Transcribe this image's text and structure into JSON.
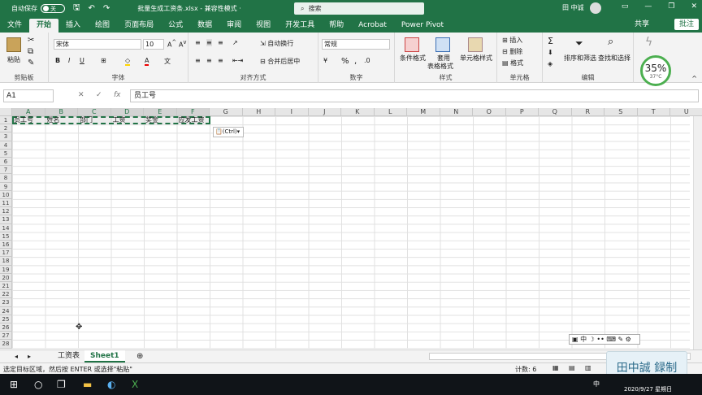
{
  "titlebar": {
    "autosave": "自动保存",
    "toggle": "关",
    "title": "批量生成工资条.xlsx  -  兼容性模式  ·",
    "search": "搜索",
    "user": "田 中诚"
  },
  "tabs": [
    "文件",
    "开始",
    "插入",
    "绘图",
    "页面布局",
    "公式",
    "数据",
    "审阅",
    "视图",
    "开发工具",
    "帮助",
    "Acrobat",
    "Power Pivot"
  ],
  "share": "共享",
  "comment": "批注",
  "ribbon": {
    "clipboard": {
      "label": "剪贴板",
      "paste": "粘贴"
    },
    "font": {
      "label": "字体",
      "name": "宋体",
      "size": "10"
    },
    "align": {
      "label": "对齐方式",
      "wrap": "自动换行",
      "merge": "合并后居中"
    },
    "number": {
      "label": "数字",
      "format": "常规"
    },
    "styles": {
      "label": "样式",
      "cond": "条件格式",
      "table1": "套用",
      "table2": "表格格式",
      "cell": "单元格样式"
    },
    "cells": {
      "label": "单元格",
      "insert": "插入",
      "delete": "删除",
      "format": "格式"
    },
    "edit": {
      "label": "编辑",
      "sort": "排序和筛选",
      "find": "查找和选择"
    },
    "gauge": {
      "pct": "35%",
      "temp": "37°C"
    }
  },
  "formula": {
    "namebox": "A1",
    "fx": "fx",
    "value": "员工号"
  },
  "columns": [
    "A",
    "B",
    "C",
    "D",
    "E",
    "F",
    "G",
    "H",
    "I",
    "J",
    "K",
    "L",
    "M",
    "N",
    "O",
    "P",
    "Q",
    "R",
    "S",
    "T",
    "U"
  ],
  "rows": [
    "1",
    "2",
    "3",
    "4",
    "5",
    "6",
    "7",
    "8",
    "9",
    "10",
    "11",
    "12",
    "13",
    "14",
    "15",
    "16",
    "17",
    "18",
    "19",
    "20",
    "21",
    "22",
    "23",
    "24",
    "25",
    "26",
    "27",
    "28"
  ],
  "header_cells": [
    "员工号",
    "姓名",
    "部门",
    "工资",
    "奖金",
    "应发工资"
  ],
  "paste_options": "(Ctrl)",
  "sheets": [
    "工资表",
    "Sheet1"
  ],
  "status": {
    "message": "选定目标区域，然后按 ENTER 或选择\"粘贴\"",
    "count": "计数: 6"
  },
  "ime": "中",
  "watermark": "田中誠 録制",
  "taskbar": {
    "time": "2020/9/27 星期日"
  }
}
